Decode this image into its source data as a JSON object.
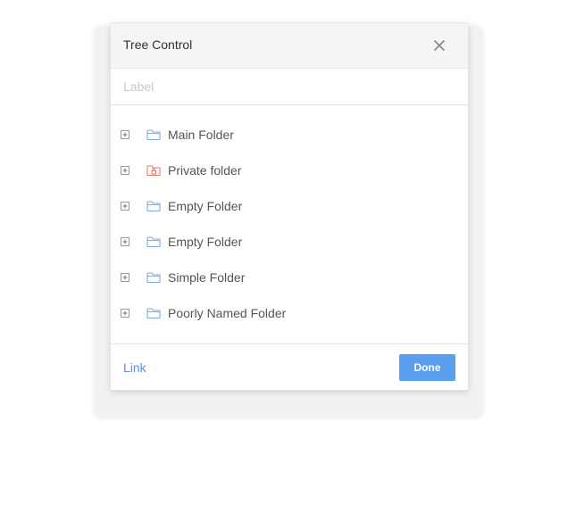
{
  "dialog": {
    "title": "Tree Control",
    "close_icon": "close-icon"
  },
  "label_field": {
    "placeholder": "Label",
    "value": ""
  },
  "tree": {
    "items": [
      {
        "label": "Main Folder",
        "icon": "folder-icon",
        "expander": "plus-square-icon",
        "icon_color": "#7aaee8"
      },
      {
        "label": "Private folder",
        "icon": "locked-folder-icon",
        "expander": "plus-square-icon",
        "icon_color": "#e07b6e"
      },
      {
        "label": "Empty Folder",
        "icon": "folder-icon",
        "expander": "plus-square-icon",
        "icon_color": "#7aaee8"
      },
      {
        "label": "Empty Folder",
        "icon": "folder-icon",
        "expander": "plus-square-icon",
        "icon_color": "#7aaee8"
      },
      {
        "label": "Simple Folder",
        "icon": "folder-icon",
        "expander": "plus-square-icon",
        "icon_color": "#7aaee8"
      },
      {
        "label": "Poorly Named Folder",
        "icon": "folder-icon",
        "expander": "plus-square-icon",
        "icon_color": "#7aaee8"
      }
    ]
  },
  "footer": {
    "link_label": "Link",
    "done_label": "Done"
  },
  "colors": {
    "accent": "#5a9ef0",
    "link": "#5b8fd8",
    "header_bg": "#f5f5f5"
  }
}
